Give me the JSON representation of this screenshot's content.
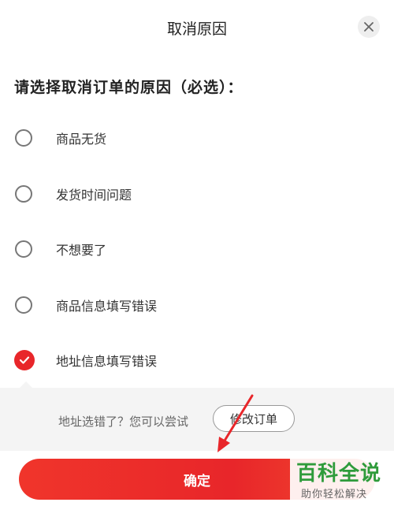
{
  "dialog": {
    "title": "取消原因",
    "close_icon": "close-icon",
    "prompt": "请选择取消订单的原因（必选）："
  },
  "options": [
    {
      "label": "商品无货",
      "checked": false
    },
    {
      "label": "发货时间问题",
      "checked": false
    },
    {
      "label": "不想要了",
      "checked": false
    },
    {
      "label": "商品信息填写错误",
      "checked": false
    },
    {
      "label": "地址信息填写错误",
      "checked": true
    }
  ],
  "hint": {
    "text": "地址选错了？您可以尝试",
    "button_label": "修改订单"
  },
  "confirm": {
    "label": "确定"
  },
  "watermark": {
    "title": "百科全说",
    "subtitle": "助你轻松解决"
  },
  "colors": {
    "accent": "#e8262a",
    "watermark_green": "#2f9b3b"
  }
}
